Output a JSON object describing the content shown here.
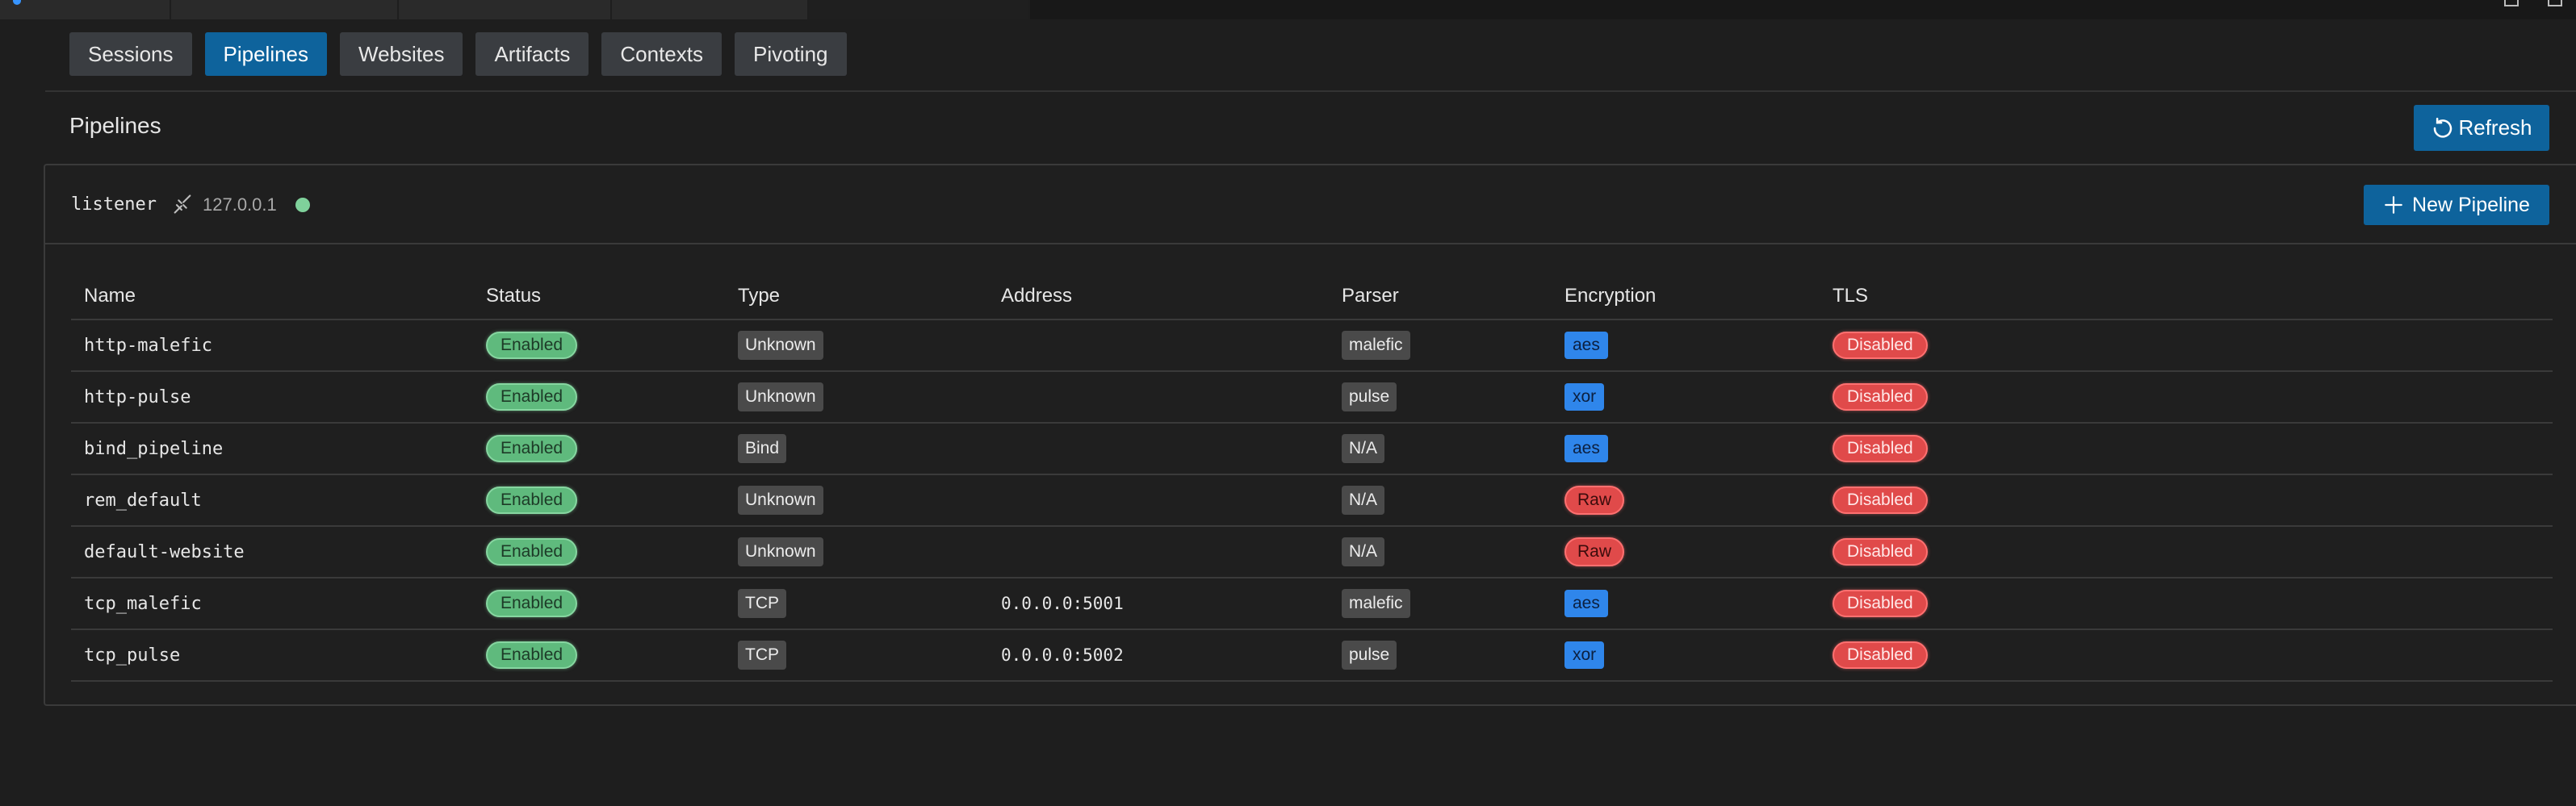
{
  "nav": {
    "tabs": [
      {
        "label": "Sessions",
        "active": false
      },
      {
        "label": "Pipelines",
        "active": true
      },
      {
        "label": "Websites",
        "active": false
      },
      {
        "label": "Artifacts",
        "active": false
      },
      {
        "label": "Contexts",
        "active": false
      },
      {
        "label": "Pivoting",
        "active": false
      }
    ]
  },
  "page": {
    "title": "Pipelines",
    "refresh_label": "Refresh",
    "refresh_icon": "refresh-icon"
  },
  "listener": {
    "name": "listener",
    "icon": "disconnect-icon",
    "ip": "127.0.0.1",
    "status_color": "#7fd19b",
    "new_pipeline_label": "New Pipeline",
    "new_pipeline_icon": "plus-icon"
  },
  "table": {
    "columns": [
      "Name",
      "Status",
      "Type",
      "Address",
      "Parser",
      "Encryption",
      "TLS"
    ],
    "rows": [
      {
        "name": "http-malefic",
        "status": "Enabled",
        "type": "Unknown",
        "address": "",
        "parser": "malefic",
        "encryption": "aes",
        "tls": "Disabled"
      },
      {
        "name": "http-pulse",
        "status": "Enabled",
        "type": "Unknown",
        "address": "",
        "parser": "pulse",
        "encryption": "xor",
        "tls": "Disabled"
      },
      {
        "name": "bind_pipeline",
        "status": "Enabled",
        "type": "Bind",
        "address": "",
        "parser": "N/A",
        "encryption": "aes",
        "tls": "Disabled"
      },
      {
        "name": "rem_default",
        "status": "Enabled",
        "type": "Unknown",
        "address": "",
        "parser": "N/A",
        "encryption": "Raw",
        "tls": "Disabled"
      },
      {
        "name": "default-website",
        "status": "Enabled",
        "type": "Unknown",
        "address": "",
        "parser": "N/A",
        "encryption": "Raw",
        "tls": "Disabled"
      },
      {
        "name": "tcp_malefic",
        "status": "Enabled",
        "type": "TCP",
        "address": "0.0.0.0:5001",
        "parser": "malefic",
        "encryption": "aes",
        "tls": "Disabled"
      },
      {
        "name": "tcp_pulse",
        "status": "Enabled",
        "type": "TCP",
        "address": "0.0.0.0:5002",
        "parser": "pulse",
        "encryption": "xor",
        "tls": "Disabled"
      }
    ]
  },
  "colors": {
    "accent": "#0e639c",
    "enabled": "#5fba7d",
    "disabled": "#e04a4a",
    "encryption_tag": "#2f86eb",
    "neutral_tag": "#4a4a4a"
  }
}
